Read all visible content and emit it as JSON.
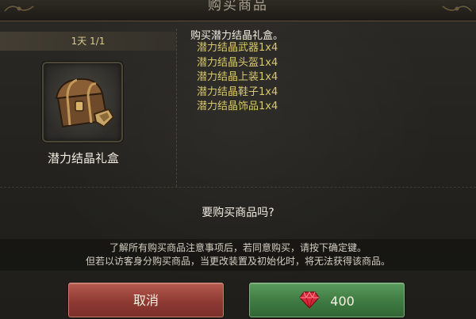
{
  "dialog": {
    "title": "购买商品"
  },
  "item": {
    "duration": "1天 1/1",
    "name": "潜力结晶礼盒",
    "icon": "treasure-chest-icon"
  },
  "description": {
    "title": "购买潜力结晶礼盒。",
    "contents": [
      "潜力结晶武器1x4",
      "潜力结晶头盔1x4",
      "潜力结晶上装1x4",
      "潜力结晶鞋子1x4",
      "潜力结晶饰品1x4"
    ]
  },
  "confirm": {
    "question": "要购买商品吗?",
    "notice_line1": "了解所有购买商品注意事项后，若同意购买，请按下确定键。",
    "notice_line2": "但若以访客身分购买商品，当更改装置及初始化时，将无法获得该商品。"
  },
  "buttons": {
    "cancel_label": "取消",
    "price": "400",
    "currency_icon": "ruby-gem-icon"
  },
  "colors": {
    "cancel": "#8e3a33",
    "confirm": "#3e7a41",
    "highlight_text": "#d8c86e"
  }
}
